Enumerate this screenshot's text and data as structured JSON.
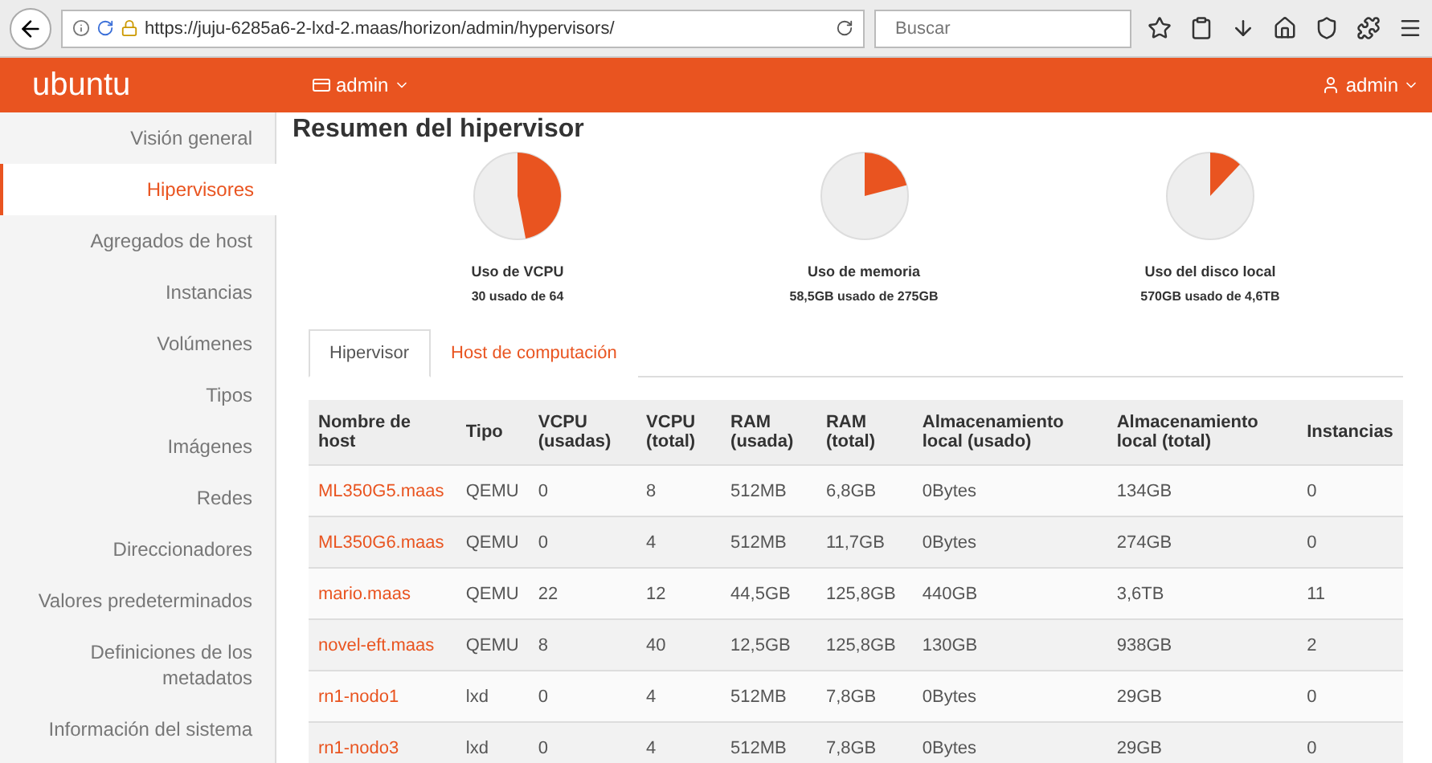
{
  "browser": {
    "url": "https://juju-6285a6-2-lxd-2.maas/horizon/admin/hypervisors/",
    "search": {
      "placeholder": "Buscar"
    }
  },
  "header": {
    "logo": "ubuntu",
    "project_menu": "admin",
    "user_menu": "admin"
  },
  "sidebar": {
    "items": [
      {
        "label": "Visión general",
        "selected": false
      },
      {
        "label": "Hipervisores",
        "selected": true
      },
      {
        "label": "Agregados de host",
        "selected": false
      },
      {
        "label": "Instancias",
        "selected": false
      },
      {
        "label": "Volúmenes",
        "selected": false
      },
      {
        "label": "Tipos",
        "selected": false
      },
      {
        "label": "Imágenes",
        "selected": false
      },
      {
        "label": "Redes",
        "selected": false
      },
      {
        "label": "Direccionadores",
        "selected": false
      },
      {
        "label": "Valores predeterminados",
        "selected": false
      },
      {
        "label": "Definiciones de los metadatos",
        "selected": false
      },
      {
        "label": "Información del sistema",
        "selected": false
      }
    ]
  },
  "summary": {
    "title": "Resumen del hipervisor",
    "charts": [
      {
        "label": "Uso de VCPU",
        "detail": "30 usado de 64"
      },
      {
        "label": "Uso de memoria",
        "detail": "58,5GB usado de 275GB"
      },
      {
        "label": "Uso del disco local",
        "detail": "570GB usado de 4,6TB"
      }
    ]
  },
  "tabs": [
    {
      "label": "Hipervisor",
      "selected": true
    },
    {
      "label": "Host de computación",
      "selected": false
    }
  ],
  "table": {
    "columns": [
      "Nombre de host",
      "Tipo",
      "VCPU (usadas)",
      "VCPU (total)",
      "RAM (usada)",
      "RAM (total)",
      "Almacenamiento local (usado)",
      "Almacenamiento local (total)",
      "Instancias"
    ],
    "rows": [
      [
        "ML350G5.maas",
        "QEMU",
        "0",
        "8",
        "512MB",
        "6,8GB",
        "0Bytes",
        "134GB",
        "0"
      ],
      [
        "ML350G6.maas",
        "QEMU",
        "0",
        "4",
        "512MB",
        "11,7GB",
        "0Bytes",
        "274GB",
        "0"
      ],
      [
        "mario.maas",
        "QEMU",
        "22",
        "12",
        "44,5GB",
        "125,8GB",
        "440GB",
        "3,6TB",
        "11"
      ],
      [
        "novel-eft.maas",
        "QEMU",
        "8",
        "40",
        "12,5GB",
        "125,8GB",
        "130GB",
        "938GB",
        "2"
      ],
      [
        "rn1-nodo1",
        "lxd",
        "0",
        "4",
        "512MB",
        "7,8GB",
        "0Bytes",
        "29GB",
        "0"
      ],
      [
        "rn1-nodo3",
        "lxd",
        "0",
        "4",
        "512MB",
        "7,8GB",
        "0Bytes",
        "29GB",
        "0"
      ]
    ]
  }
}
